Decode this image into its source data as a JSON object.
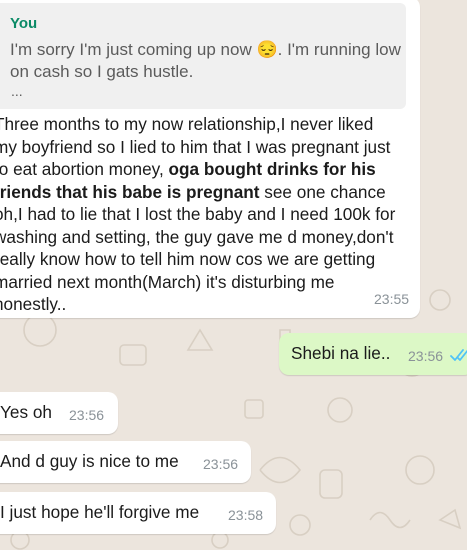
{
  "reply_quote": {
    "author": "You",
    "text_before": "I'm sorry I'm just coming up now ",
    "emoji": "😔",
    "text_after": ". I'm running low on cash so I gats hustle.",
    "ellipsis": "..."
  },
  "messages": [
    {
      "text_parts": [
        "Three months to my now relationship,I never liked my boyfriend so I lied to him that I was pregnant just to eat abortion money, ",
        "oga bought drinks for his friends that his babe is pregnant",
        " see one chance oh,I had to lie that I lost the baby and I need 100k for washing and setting, the guy gave me d money,don't really know how to tell him now cos we are getting married next month(March) it's disturbing me honestly.."
      ],
      "time": "23:55"
    },
    {
      "text": "Shebi na lie..",
      "time": "23:56",
      "status": "read"
    },
    {
      "text": "Yes oh",
      "time": "23:56"
    },
    {
      "text": "And d guy is nice to me",
      "time": "23:56"
    },
    {
      "text": "I just hope he'll forgive me",
      "time": "23:58"
    }
  ],
  "colors": {
    "wallpaper": "#ece5dd",
    "incoming_bubble": "#ffffff",
    "outgoing_bubble": "#dcf8c6",
    "quote_accent": "#06cf9c",
    "read_ticks": "#4fc3f7",
    "timestamp": "#8a9298"
  },
  "icons": [
    "double-check-read-icon"
  ]
}
